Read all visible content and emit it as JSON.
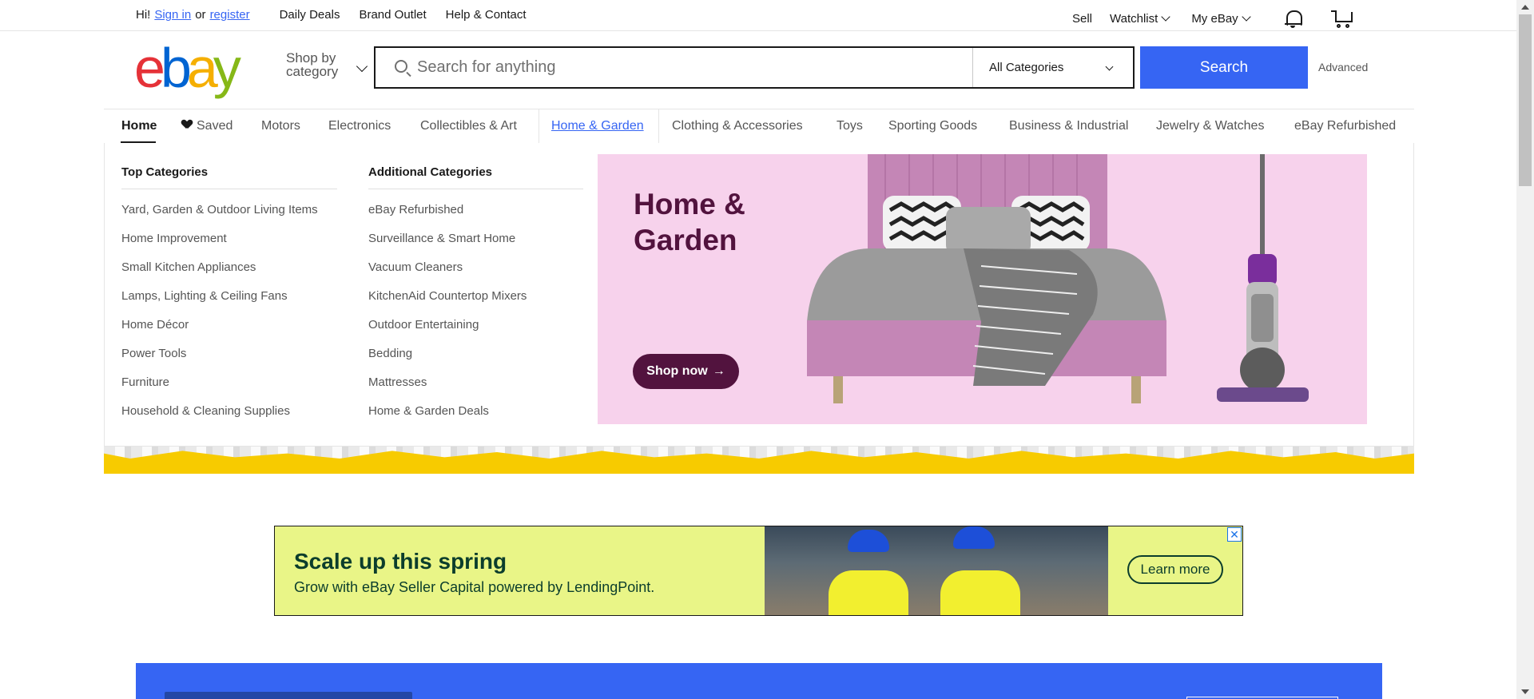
{
  "topbar": {
    "greeting": "Hi!",
    "sign_in": "Sign in",
    "or": "or",
    "register": "register",
    "links": [
      "Daily Deals",
      "Brand Outlet",
      "Help & Contact"
    ],
    "sell": "Sell",
    "watchlist": "Watchlist",
    "my_ebay": "My eBay",
    "icons": [
      "bell-icon",
      "cart-icon"
    ]
  },
  "header": {
    "logo_letters": [
      "e",
      "b",
      "a",
      "y"
    ],
    "logo_colors": [
      "#e53238",
      "#0064d2",
      "#f5af02",
      "#86b817"
    ],
    "shop_by_line1": "Shop by",
    "shop_by_line2": "category",
    "search_placeholder": "Search for anything",
    "category_select": "All Categories",
    "search_button": "Search",
    "advanced": "Advanced"
  },
  "nav": {
    "items": [
      "Home",
      "Saved",
      "Motors",
      "Electronics",
      "Collectibles & Art",
      "Home & Garden",
      "Clothing & Accessories",
      "Toys",
      "Sporting Goods",
      "Business & Industrial",
      "Jewelry & Watches",
      "eBay Refurbished"
    ]
  },
  "dropdown": {
    "top_categories": {
      "heading": "Top Categories",
      "items": [
        "Yard, Garden & Outdoor Living Items",
        "Home Improvement",
        "Small Kitchen Appliances",
        "Lamps, Lighting & Ceiling Fans",
        "Home Décor",
        "Power Tools",
        "Furniture",
        "Household & Cleaning Supplies"
      ]
    },
    "additional_categories": {
      "heading": "Additional Categories",
      "items": [
        "eBay Refurbished",
        "Surveillance & Smart Home",
        "Vacuum Cleaners",
        "KitchenAid Countertop Mixers",
        "Outdoor Entertaining",
        "Bedding",
        "Mattresses",
        "Home & Garden Deals"
      ]
    },
    "banner": {
      "title": "Home & Garden",
      "button": "Shop now",
      "bg_color": "#f7d2ec",
      "accent_color": "#52133e"
    }
  },
  "ad": {
    "title": "Scale up this spring",
    "subtitle": "Grow with eBay Seller Capital powered by LendingPoint.",
    "button": "Learn more",
    "close": "✕"
  },
  "colors": {
    "primary_blue": "#3665f3",
    "ad_bg": "#e9f587"
  }
}
